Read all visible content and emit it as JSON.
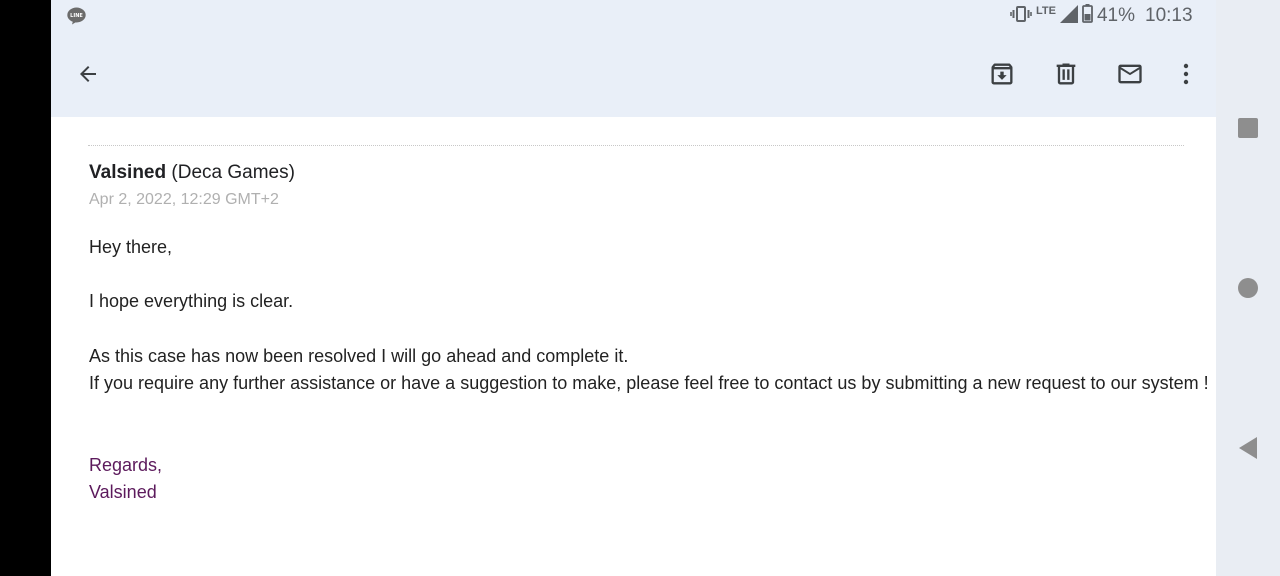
{
  "status_bar": {
    "app_badge": "LINE",
    "network": "LTE",
    "battery": "41%",
    "time": "10:13"
  },
  "toolbar": {
    "icons": [
      "back-arrow-icon",
      "archive-icon",
      "delete-icon",
      "mark-unread-icon",
      "more-vert-icon"
    ]
  },
  "email": {
    "sender_name": "Valsined",
    "sender_org": "(Deca Games)",
    "date": "Apr 2, 2022, 12:29 GMT+2",
    "body": [
      "Hey there,",
      "I hope everything is clear.",
      "As this case has now been resolved I will go ahead and complete it.",
      "If you require any further assistance or have a suggestion to make, please feel free to contact us by submitting a new request to our system !"
    ],
    "signature": [
      "Regards,",
      "Valsined"
    ]
  },
  "colors": {
    "header_bg": "#e9eff8",
    "signature": "#5c1a5c",
    "date": "#b0b0b0",
    "nav_rail": "#e9edf3"
  }
}
